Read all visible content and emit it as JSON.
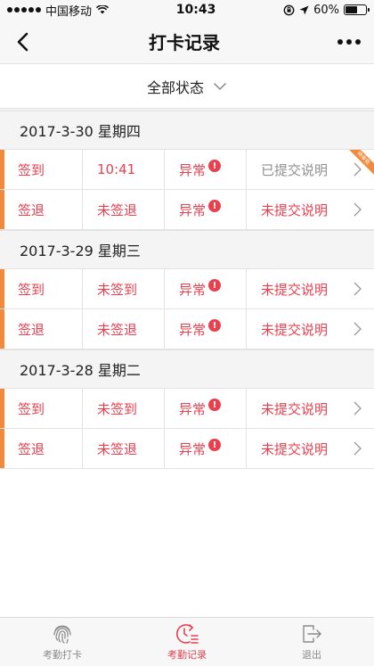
{
  "status": {
    "carrier": "中国移动",
    "time": "10:43",
    "battery": "60%",
    "battery_level": 0.6
  },
  "nav": {
    "title": "打卡记录"
  },
  "filter": {
    "label": "全部状态"
  },
  "days": [
    {
      "date": "2017-3-30  星期四",
      "rows": [
        {
          "type": "签到",
          "time": "10:41",
          "status": "异常",
          "note": "已提交说明",
          "ribbon": "待审批"
        },
        {
          "type": "签退",
          "time": "未签退",
          "status": "异常",
          "note": "未提交说明"
        }
      ]
    },
    {
      "date": "2017-3-29  星期三",
      "rows": [
        {
          "type": "签到",
          "time": "未签到",
          "status": "异常",
          "note": "未提交说明"
        },
        {
          "type": "签退",
          "time": "未签退",
          "status": "异常",
          "note": "未提交说明"
        }
      ]
    },
    {
      "date": "2017-3-28  星期二",
      "rows": [
        {
          "type": "签到",
          "time": "未签到",
          "status": "异常",
          "note": "未提交说明"
        },
        {
          "type": "签退",
          "time": "未签退",
          "status": "异常",
          "note": "未提交说明"
        }
      ]
    }
  ],
  "tabs": [
    {
      "label": "考勤打卡",
      "icon": "fingerprint-icon"
    },
    {
      "label": "考勤记录",
      "icon": "clock-list-icon",
      "active": true
    },
    {
      "label": "退出",
      "icon": "exit-icon"
    }
  ],
  "colors": {
    "accent": "#e8404f",
    "stripe": "#f28a3c",
    "muted": "#8f8f8f"
  }
}
